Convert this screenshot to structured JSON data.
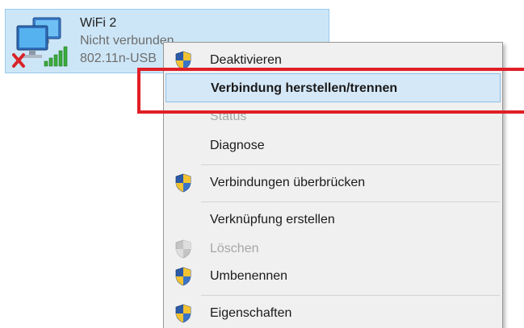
{
  "adapter": {
    "name": "WiFi 2",
    "status": "Nicht verbunden",
    "device": "802.11n-USB"
  },
  "menu": {
    "items": [
      {
        "label": "Deaktivieren",
        "icon": "uac-shield-icon",
        "enabled": true,
        "bold": false
      },
      {
        "label": "Verbindung herstellen/trennen",
        "icon": "",
        "enabled": true,
        "bold": true,
        "highlighted": true
      },
      {
        "label": "Status",
        "icon": "",
        "enabled": false,
        "bold": false
      },
      {
        "label": "Diagnose",
        "icon": "",
        "enabled": true,
        "bold": false
      },
      {
        "label": "Verbindungen überbrücken",
        "icon": "uac-shield-icon",
        "enabled": true,
        "bold": false
      },
      {
        "label": "Verknüpfung erstellen",
        "icon": "",
        "enabled": true,
        "bold": false
      },
      {
        "label": "Löschen",
        "icon": "uac-shield-disabled-icon",
        "enabled": false,
        "bold": false
      },
      {
        "label": "Umbenennen",
        "icon": "uac-shield-icon",
        "enabled": true,
        "bold": false
      },
      {
        "label": "Eigenschaften",
        "icon": "uac-shield-icon",
        "enabled": true,
        "bold": false
      }
    ]
  },
  "colors": {
    "selection": "#cde6f7",
    "highlight": "#d5e8f8",
    "annotation": "#e01f26"
  }
}
